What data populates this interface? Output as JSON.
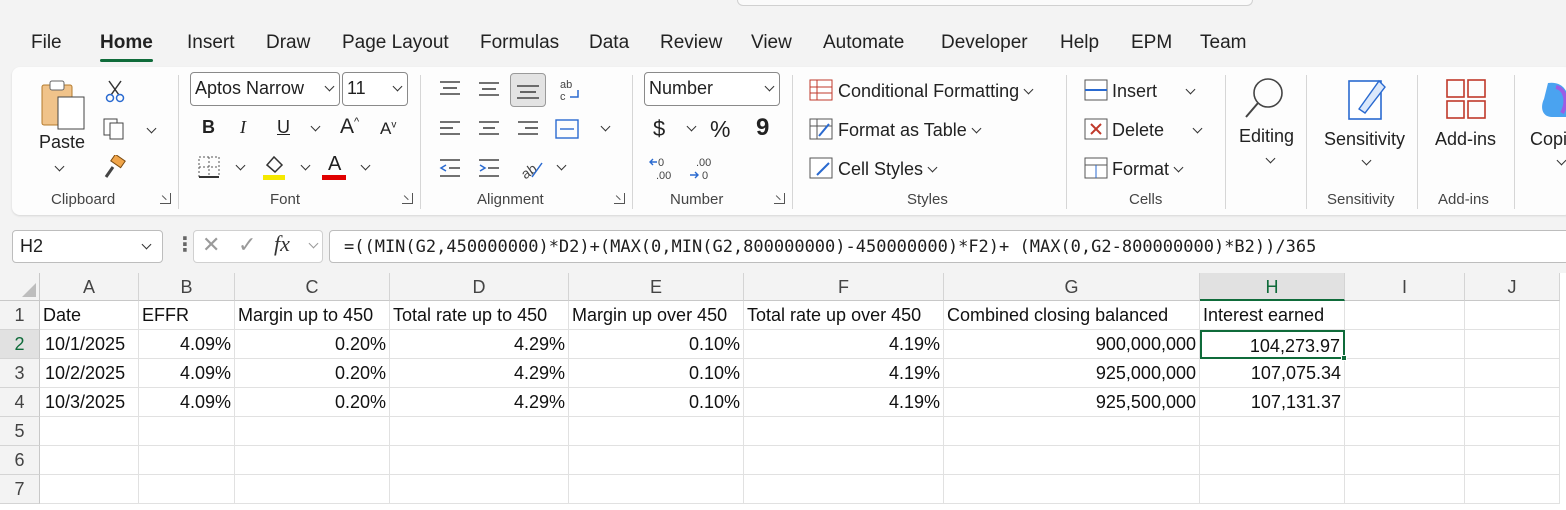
{
  "menu": [
    "File",
    "Home",
    "Insert",
    "Draw",
    "Page Layout",
    "Formulas",
    "Data",
    "Review",
    "View",
    "Automate",
    "Developer",
    "Help",
    "EPM",
    "Team"
  ],
  "active_tab": "Home",
  "clipboard": {
    "paste": "Paste",
    "label": "Clipboard"
  },
  "font": {
    "name": "Aptos Narrow",
    "size": "11",
    "bold": "B",
    "italic": "I",
    "underline": "U",
    "grow": "A",
    "shrink": "A",
    "color_letter": "A",
    "label": "Font",
    "highlight_color": "#f5e900",
    "font_color": "#e00000"
  },
  "alignment": {
    "label": "Alignment"
  },
  "number": {
    "format": "Number",
    "currency": "$",
    "percent": "%",
    "comma": "9",
    "label": "Number"
  },
  "styles": {
    "conditional": "Conditional Formatting",
    "table": "Format as Table",
    "cell_styles": "Cell Styles",
    "label": "Styles"
  },
  "cells": {
    "insert": "Insert",
    "delete": "Delete",
    "format": "Format",
    "label": "Cells"
  },
  "editing": {
    "label": "Editing"
  },
  "sensitivity": {
    "button": "Sensitivity",
    "label": "Sensitivity"
  },
  "addins": {
    "button": "Add-ins",
    "label": "Add-ins"
  },
  "copilot": {
    "button": "Copi"
  },
  "formula_bar": {
    "cell_ref": "H2",
    "fx": "fx",
    "formula": "=((MIN(G2,450000000)*D2)+(MAX(0,MIN(G2,800000000)-450000000)*F2)+ (MAX(0,G2-800000000)*B2))/365"
  },
  "sheet": {
    "columns": [
      "A",
      "B",
      "C",
      "D",
      "E",
      "F",
      "G",
      "H",
      "I",
      "J"
    ],
    "selected_column": "H",
    "selected_row": "2",
    "rows": [
      "1",
      "2",
      "3",
      "4",
      "5",
      "6",
      "7"
    ],
    "headers": [
      "Date",
      "EFFR",
      "Margin up to 450",
      "Total rate up to 450",
      "Margin up over 450",
      "Total rate up over 450",
      "Combined closing balanced",
      "Interest earned"
    ],
    "data": [
      [
        "10/1/2025",
        "4.09%",
        "0.20%",
        "4.29%",
        "0.10%",
        "4.19%",
        "900,000,000",
        "104,273.97"
      ],
      [
        "10/2/2025",
        "4.09%",
        "0.20%",
        "4.29%",
        "0.10%",
        "4.19%",
        "925,000,000",
        "107,075.34"
      ],
      [
        "10/3/2025",
        "4.09%",
        "0.20%",
        "4.29%",
        "0.10%",
        "4.19%",
        "925,500,000",
        "107,131.37"
      ]
    ]
  },
  "accent": "#0f6b3a"
}
